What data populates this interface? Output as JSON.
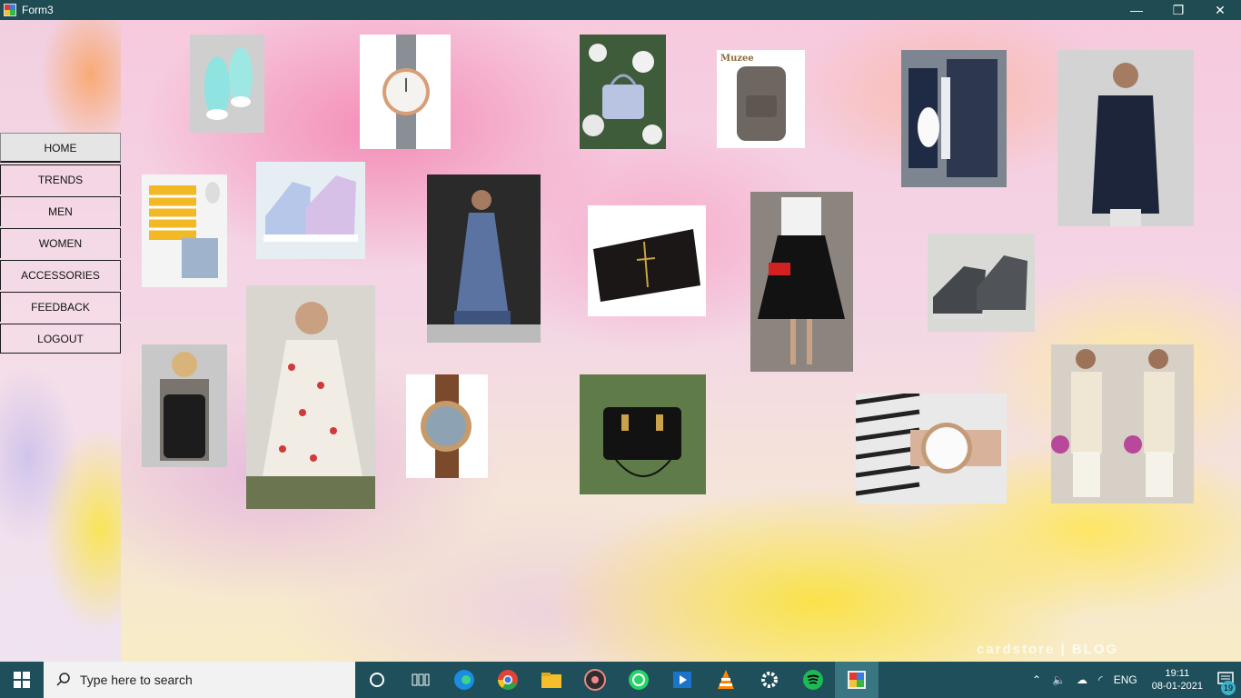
{
  "window": {
    "title": "Form3",
    "minimize_glyph": "—",
    "restore_glyph": "❐",
    "close_glyph": "✕"
  },
  "nav": {
    "items": [
      {
        "label": "HOME"
      },
      {
        "label": "TRENDS"
      },
      {
        "label": "MEN"
      },
      {
        "label": "WOMEN"
      },
      {
        "label": "ACCESSORIES"
      },
      {
        "label": "FEEDBACK"
      },
      {
        "label": "LOGOUT"
      }
    ]
  },
  "background_watermark": "cardstore | BLOG",
  "product_tiles": {
    "backpack_brand": "Muzee"
  },
  "taskbar": {
    "search_placeholder": "Type here to search",
    "icons": [
      "windows-start-icon",
      "cortana-icon",
      "task-view-icon",
      "edge-icon",
      "chrome-icon",
      "file-explorer-icon",
      "music-app-icon",
      "whatsapp-icon",
      "media-player-icon",
      "vlc-icon",
      "settings-icon",
      "spotify-icon",
      "form-app-icon"
    ],
    "tray": {
      "language": "ENG",
      "time": "19:11",
      "date": "08-01-2021",
      "notification_count": "19"
    }
  },
  "colors": {
    "titlebar": "#1f4b52",
    "taskbar": "#1e4f5a",
    "nav_active": "#e5e5e5"
  }
}
